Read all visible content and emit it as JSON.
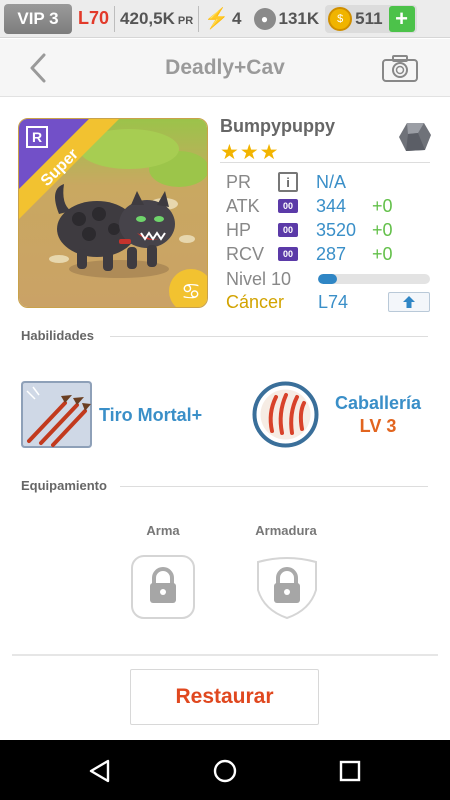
{
  "topbar": {
    "vip": "VIP 3",
    "level": "L70",
    "power": "420,5K",
    "power_unit": "PR",
    "energy": "4",
    "food": "131K",
    "coins": "511",
    "add_label": "+"
  },
  "header": {
    "title": "Deadly+Cav",
    "back_icon": "chevron-left-icon",
    "camera_icon": "camera-icon"
  },
  "creature": {
    "rarity_badge": "Super",
    "rank_letter": "R",
    "name": "Bumpypuppy",
    "stars": "★★★",
    "element_icon": "rock-icon",
    "zodiac_icon": "cancer-icon",
    "stats": [
      {
        "label": "PR",
        "value": "N/A",
        "bonus": ""
      },
      {
        "label": "ATK",
        "badge": "00",
        "value": "344",
        "bonus": "+0"
      },
      {
        "label": "HP",
        "badge": "00",
        "value": "3520",
        "bonus": "+0"
      },
      {
        "label": "RCV",
        "badge": "00",
        "value": "287",
        "bonus": "+0"
      }
    ],
    "info_glyph": "i",
    "level_label": "Nivel 10",
    "level_progress_percent": 17,
    "sign_label": "Cáncer",
    "sign_level": "L74",
    "upgrade_icon": "arrow-up-icon"
  },
  "abilities": {
    "section_title": "Habilidades",
    "skill_name": "Tiro Mortal+",
    "perk_name": "Caballería",
    "perk_level": "LV 3"
  },
  "equipment": {
    "section_title": "Equipamiento",
    "weapon_label": "Arma",
    "armor_label": "Armadura"
  },
  "actions": {
    "restore_label": "Restaurar"
  },
  "colors": {
    "accent_blue": "#3a8fc8",
    "accent_orange": "#e0481f",
    "level_red": "#e23a2a",
    "gold": "#f2b400",
    "green": "#63c04a"
  }
}
